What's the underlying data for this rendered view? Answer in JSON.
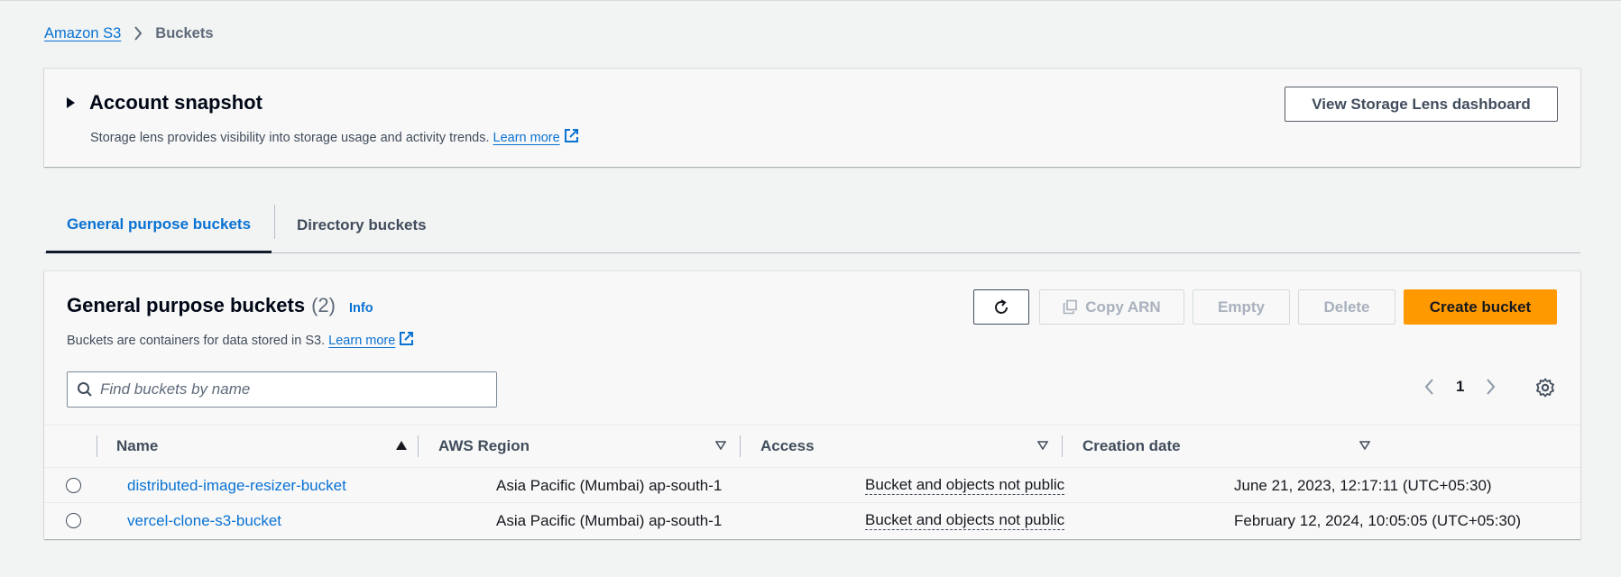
{
  "breadcrumb": {
    "root": "Amazon S3",
    "current": "Buckets"
  },
  "snapshot": {
    "title": "Account snapshot",
    "description": "Storage lens provides visibility into storage usage and activity trends.",
    "learn_more": "Learn more",
    "lens_button": "View Storage Lens dashboard"
  },
  "tabs": {
    "general": "General purpose buckets",
    "directory": "Directory buckets"
  },
  "buckets": {
    "title": "General purpose buckets",
    "count": "(2)",
    "info": "Info",
    "description": "Buckets are containers for data stored in S3.",
    "learn_more": "Learn more",
    "actions": {
      "copy_arn": "Copy ARN",
      "empty": "Empty",
      "delete": "Delete",
      "create": "Create bucket"
    },
    "search_placeholder": "Find buckets by name",
    "page": "1",
    "columns": {
      "name": "Name",
      "region": "AWS Region",
      "access": "Access",
      "created": "Creation date"
    },
    "rows": [
      {
        "name": "distributed-image-resizer-bucket",
        "region": "Asia Pacific (Mumbai) ap-south-1",
        "access": "Bucket and objects not public",
        "created": "June 21, 2023, 12:17:11 (UTC+05:30)"
      },
      {
        "name": "vercel-clone-s3-bucket",
        "region": "Asia Pacific (Mumbai) ap-south-1",
        "access": "Bucket and objects not public",
        "created": "February 12, 2024, 10:05:05 (UTC+05:30)"
      }
    ]
  },
  "colors": {
    "link": "#0972d3",
    "primary": "#ff9900",
    "text": "#16191f"
  }
}
